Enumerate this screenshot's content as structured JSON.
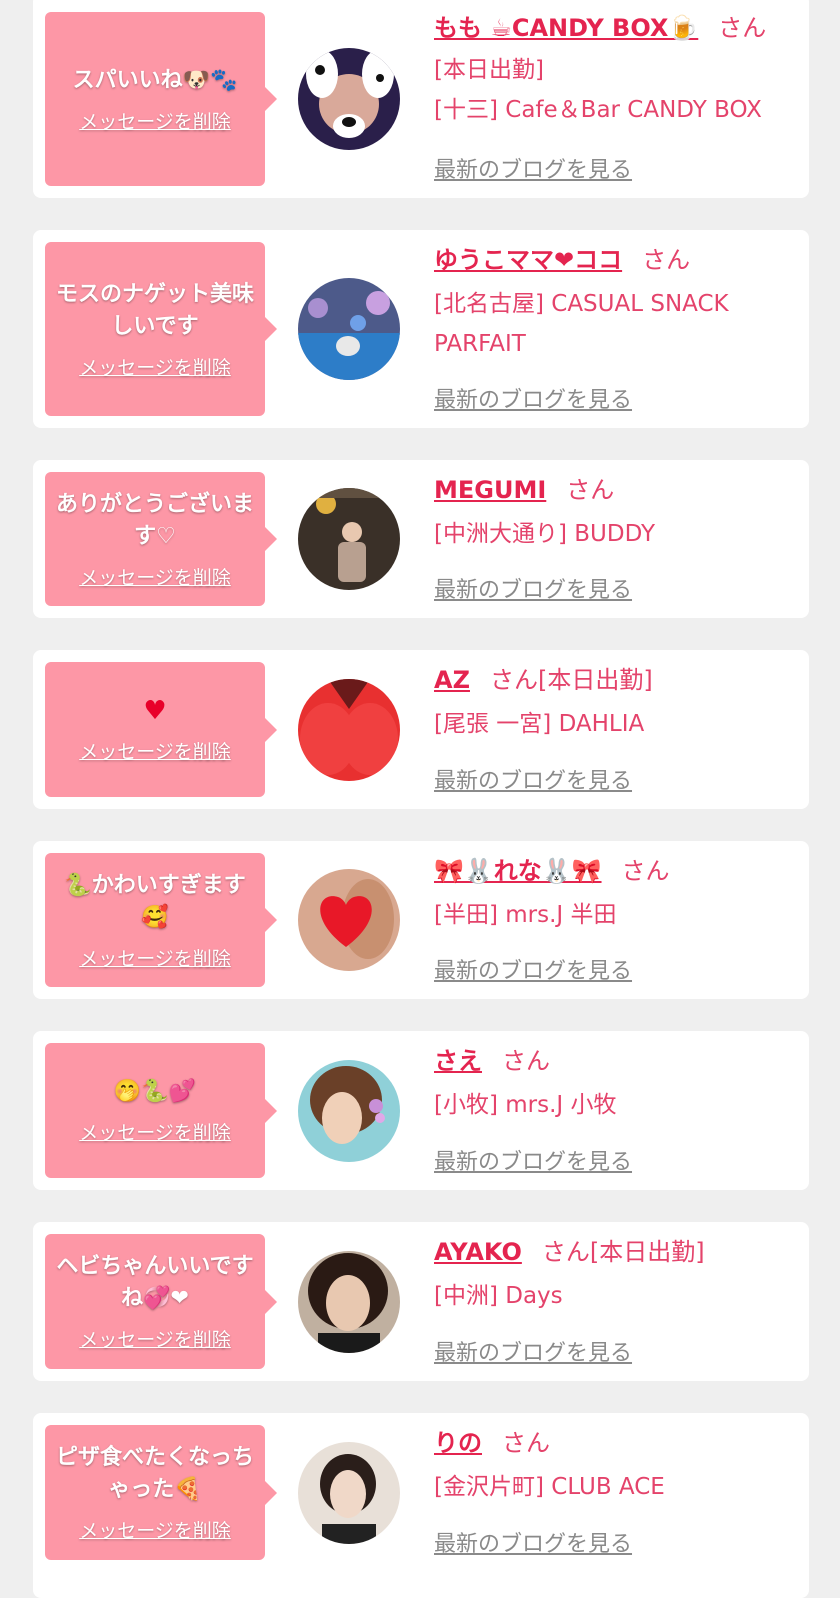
{
  "messages": [
    {
      "message": "スパいいね🐶🐾",
      "delete_label": "メッセージを削除",
      "name": "もも ☕CANDY BOX🍺",
      "san": "さん",
      "status": "[本日出勤]",
      "shop_lines": [
        "[十三] Cafe＆Bar CANDY BOX"
      ],
      "blog_label": "最新のブログを見る",
      "avatar": "avatar-dog-filter"
    },
    {
      "message": "モスのナゲット美味しいです",
      "delete_label": "メッセージを削除",
      "name": "ゆうこママ❤ココ",
      "san": "さん",
      "status": "",
      "shop_lines": [
        "[北名古屋] CASUAL SNACK",
        "PARFAIT"
      ],
      "blog_label": "最新のブログを見る",
      "avatar": "avatar-blue-room"
    },
    {
      "message": "ありがとうございます♡",
      "delete_label": "メッセージを削除",
      "name": "MEGUMI",
      "san": "さん",
      "status": "",
      "shop_lines": [
        "[中洲大通り] BUDDY"
      ],
      "blog_label": "最新のブログを見る",
      "avatar": "avatar-kimono"
    },
    {
      "message": "♥",
      "delete_label": "メッセージを削除",
      "name": "AZ",
      "san": "さん",
      "status": "[本日出勤]",
      "shop_lines": [
        "[尾張 一宮] DAHLIA"
      ],
      "blog_label": "最新のブログを見る",
      "avatar": "avatar-red-heart"
    },
    {
      "message": "🐍かわいすぎます🥰",
      "delete_label": "メッセージを削除",
      "name": "🎀🐰れな🐰🎀",
      "san": "さん",
      "status": "",
      "shop_lines": [
        "[半田] mrs.J 半田"
      ],
      "blog_label": "最新のブログを見る",
      "avatar": "avatar-heart-face"
    },
    {
      "message": "🤭🐍💕",
      "delete_label": "メッセージを削除",
      "name": "さえ",
      "san": "さん",
      "status": "",
      "shop_lines": [
        "[小牧] mrs.J 小牧"
      ],
      "blog_label": "最新のブログを見る",
      "avatar": "avatar-hair-flower"
    },
    {
      "message": "ヘビちゃんいいですね💞❤",
      "delete_label": "メッセージを削除",
      "name": "AYAKO",
      "san": "さん",
      "status": "[本日出勤]",
      "shop_lines": [
        "[中洲] Days"
      ],
      "blog_label": "最新のブログを見る",
      "avatar": "avatar-selfie"
    },
    {
      "message": "ピザ食べたくなっちゃった🍕",
      "delete_label": "メッセージを削除",
      "name": "りの",
      "san": "さん",
      "status": "",
      "shop_lines": [
        "[金沢片町] CLUB ACE"
      ],
      "blog_label": "最新のブログを見る",
      "avatar": "avatar-short-hair"
    }
  ]
}
